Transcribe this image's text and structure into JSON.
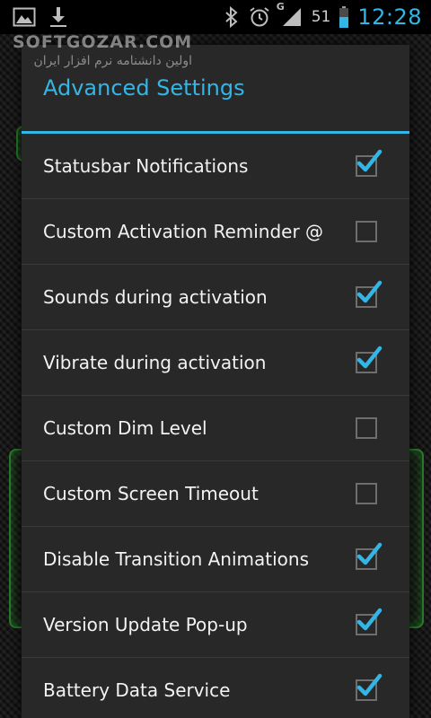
{
  "statusbar": {
    "left_icons": [
      "image-icon",
      "download-icon"
    ],
    "right_icons": [
      "bluetooth-icon",
      "alarm-icon",
      "signal-icon",
      "battery-icon"
    ],
    "signal_label": "G",
    "battery_percent": "51",
    "time": "12:28"
  },
  "watermark": {
    "brand": "SOFTGOZAR.COM",
    "subtitle": "اولین دانشنامه نرم افزار ایران"
  },
  "dialog": {
    "title": "Advanced Settings",
    "accent_color": "#33b5e5",
    "items": [
      {
        "label": "Statusbar Notifications",
        "checked": true
      },
      {
        "label": "Custom Activation Reminder @",
        "checked": false
      },
      {
        "label": "Sounds during activation",
        "checked": true
      },
      {
        "label": "Vibrate during activation",
        "checked": true
      },
      {
        "label": "Custom Dim Level",
        "checked": false
      },
      {
        "label": "Custom Screen Timeout",
        "checked": false
      },
      {
        "label": "Disable Transition Animations",
        "checked": true
      },
      {
        "label": "Version Update Pop-up",
        "checked": true
      },
      {
        "label": "Battery Data Service",
        "checked": true
      }
    ]
  }
}
